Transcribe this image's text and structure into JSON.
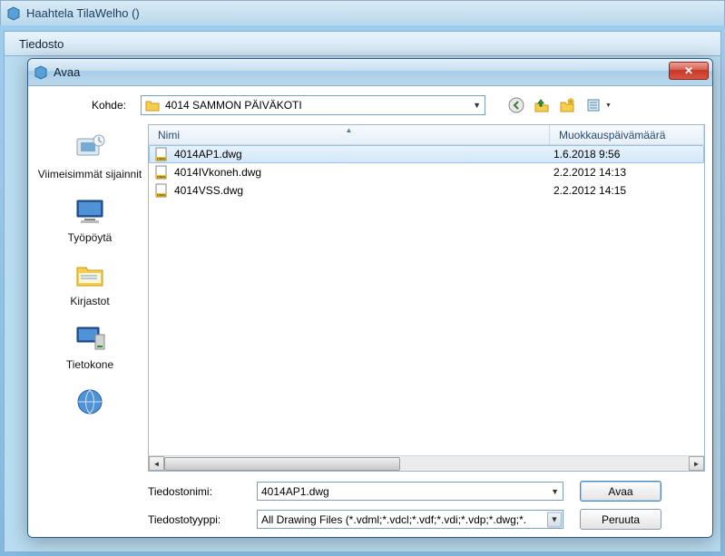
{
  "parent": {
    "title": "Haahtela TilaWelho ()",
    "menu": {
      "file": "Tiedosto"
    }
  },
  "dialog": {
    "title": "Avaa",
    "look_in_label": "Kohde:",
    "look_in_value": "4014 SAMMON PÄIVÄKOTI",
    "nav": {
      "back": "back-icon",
      "up": "up-one-level-icon",
      "new_folder": "new-folder-icon",
      "view": "view-menu-icon"
    },
    "columns": {
      "name": "Nimi",
      "modified": "Muokkauspäivämäärä"
    },
    "files": [
      {
        "name": "4014AP1.dwg",
        "modified": "1.6.2018 9:56",
        "selected": true
      },
      {
        "name": "4014IVkoneh.dwg",
        "modified": "2.2.2012 14:13",
        "selected": false
      },
      {
        "name": "4014VSS.dwg",
        "modified": "2.2.2012 14:15",
        "selected": false
      }
    ],
    "places": [
      {
        "key": "recent",
        "label": "Viimeisimmät sijainnit"
      },
      {
        "key": "desktop",
        "label": "Työpöytä"
      },
      {
        "key": "libraries",
        "label": "Kirjastot"
      },
      {
        "key": "computer",
        "label": "Tietokone"
      },
      {
        "key": "network",
        "label": ""
      }
    ],
    "filename_label": "Tiedostonimi:",
    "filename_value": "4014AP1.dwg",
    "filetype_label": "Tiedostotyyppi:",
    "filetype_value": "All Drawing Files (*.vdml;*.vdcl;*.vdf;*.vdi;*.vdp;*.dwg;*.",
    "buttons": {
      "open": "Avaa",
      "cancel": "Peruuta"
    }
  }
}
